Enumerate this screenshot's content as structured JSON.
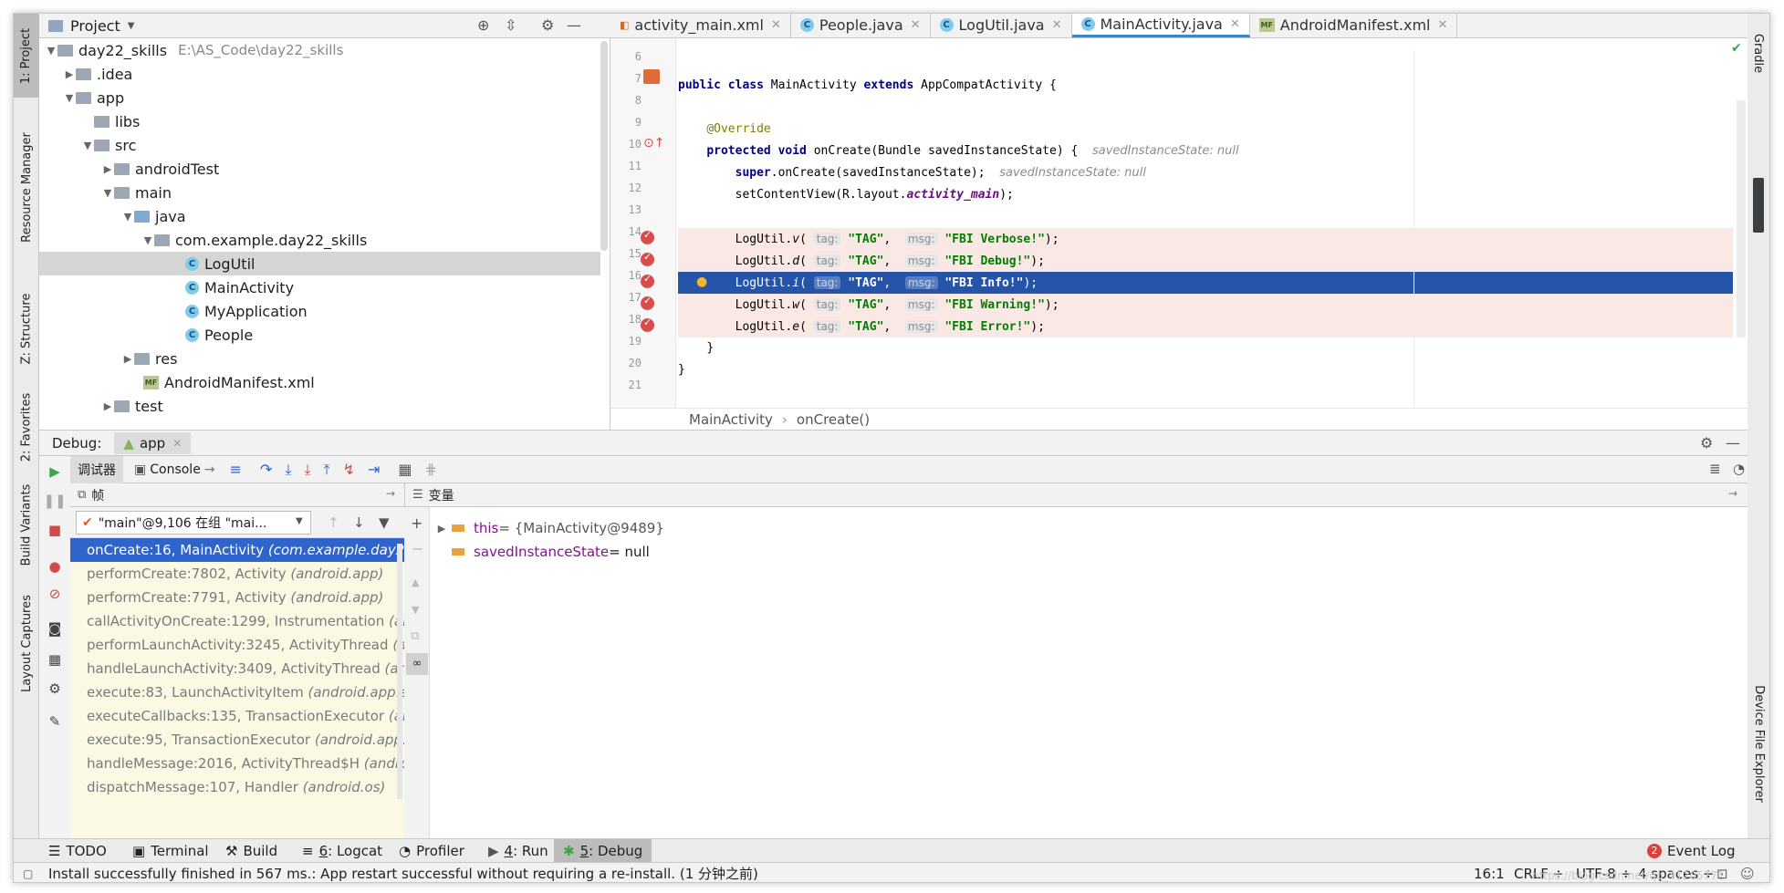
{
  "left_tool_strip": [
    "1: Project",
    "Resource Manager",
    "Z: Structure",
    "2: Favorites",
    "Build Variants",
    "Layout Captures"
  ],
  "right_tool_strip": [
    "Gradle",
    "Device File Explorer"
  ],
  "project": {
    "title": "Project",
    "tree": [
      {
        "label": "day22_skills",
        "path": "E:\\AS_Code\\day22_skills"
      },
      {
        "label": ".idea"
      },
      {
        "label": "app"
      },
      {
        "label": "libs"
      },
      {
        "label": "src"
      },
      {
        "label": "androidTest"
      },
      {
        "label": "main"
      },
      {
        "label": "java"
      },
      {
        "label": "com.example.day22_skills"
      },
      {
        "label": "LogUtil"
      },
      {
        "label": "MainActivity"
      },
      {
        "label": "MyApplication"
      },
      {
        "label": "People"
      },
      {
        "label": "res"
      },
      {
        "label": "AndroidManifest.xml"
      },
      {
        "label": "test"
      }
    ]
  },
  "editor": {
    "tabs": [
      "activity_main.xml",
      "People.java",
      "LogUtil.java",
      "MainActivity.java",
      "AndroidManifest.xml"
    ],
    "active_tab": "MainActivity.java",
    "line_numbers": [
      "6",
      "7",
      "8",
      "9",
      "10",
      "11",
      "12",
      "13",
      "14",
      "15",
      "16",
      "17",
      "18",
      "19",
      "20",
      "21"
    ],
    "code": {
      "l7_kw1": "public class",
      "l7_name": " MainActivity ",
      "l7_kw2": "extends",
      "l7_rest": " AppCompatActivity {",
      "l9": "@Override",
      "l10_kw": "protected void",
      "l10_rest": " onCreate(Bundle savedInstanceState) {",
      "l10_hint": "savedInstanceState: null",
      "l11_kw": "super",
      "l11_rest": ".onCreate(savedInstanceState);",
      "l11_hint": "savedInstanceState: null",
      "l12_a": "setContentView(R.layout.",
      "l12_field": "activity_main",
      "l12_b": ");",
      "log_prefix": "LogUtil.",
      "tag_hint": "tag:",
      "msg_hint": "msg:",
      "tag_value": "\"TAG\"",
      "calls": [
        {
          "method": "v",
          "msg": "\"FBI Verbose!\""
        },
        {
          "method": "d",
          "msg": "\"FBI Debug!\""
        },
        {
          "method": "i",
          "msg": "\"FBI Info!\""
        },
        {
          "method": "w",
          "msg": "\"FBI Warning!\""
        },
        {
          "method": "e",
          "msg": "\"FBI Error!\""
        }
      ],
      "close_inner": "}",
      "close_outer": "}"
    },
    "breadcrumb": [
      "MainActivity",
      "onCreate()"
    ]
  },
  "debug": {
    "title": "Debug:",
    "config_tab": "app",
    "debugger_tab": "调试器",
    "console_tab": "Console",
    "frames_title": "帧",
    "thread_select": "\"main\"@9,106 在组 \"mai...",
    "frames": [
      {
        "method": "onCreate:16, MainActivity",
        "pkg": "(com.example.day22"
      },
      {
        "method": "performCreate:7802, Activity",
        "pkg": "(android.app)"
      },
      {
        "method": "performCreate:7791, Activity",
        "pkg": "(android.app)"
      },
      {
        "method": "callActivityOnCreate:1299, Instrumentation",
        "pkg": "(and"
      },
      {
        "method": "performLaunchActivity:3245, ActivityThread",
        "pkg": "(an"
      },
      {
        "method": "handleLaunchActivity:3409, ActivityThread",
        "pkg": "(and"
      },
      {
        "method": "execute:83, LaunchActivityItem",
        "pkg": "(android.app.se"
      },
      {
        "method": "executeCallbacks:135, TransactionExecutor",
        "pkg": "(an"
      },
      {
        "method": "execute:95, TransactionExecutor",
        "pkg": "(android.app.s"
      },
      {
        "method": "handleMessage:2016, ActivityThread$H",
        "pkg": "(andro"
      },
      {
        "method": "dispatchMessage:107, Handler",
        "pkg": "(android.os)"
      }
    ],
    "variables_title": "变量",
    "variables": [
      {
        "name": "this",
        "value": " = {MainActivity@9489}"
      },
      {
        "name": "savedInstanceState",
        "value": " = null"
      }
    ]
  },
  "bottom_tabs": [
    {
      "icon": "☰",
      "key": "",
      "label": "TODO"
    },
    {
      "icon": "▣",
      "key": "",
      "label": "Terminal"
    },
    {
      "icon": "⚒",
      "key": "",
      "label": "Build"
    },
    {
      "icon": "≡",
      "key": "6",
      "label": ": Logcat"
    },
    {
      "icon": "◔",
      "key": "",
      "label": "Profiler"
    },
    {
      "icon": "▶",
      "key": "4",
      "label": ": Run"
    },
    {
      "icon": "✱",
      "key": "5",
      "label": ": Debug"
    }
  ],
  "event_log": {
    "count": "2",
    "label": "Event Log"
  },
  "status": {
    "message": "Install successfully finished in 567 ms.: App restart successful without requiring a re-install. (1 分钟之前)",
    "position": "16:1",
    "line_sep": "CRLF ÷",
    "encoding": "UTF-8 ÷",
    "indent": "4 spaces ÷",
    "watermark": "https://blog.csdn.net/qq_41205771"
  },
  "colors": {
    "accent": "#2f65ca",
    "current_line": "#2654a9",
    "breakpoint_line": "#fae8e5",
    "breakpoint": "#dc4b4b",
    "frames_bg": "#fbf9e4"
  }
}
